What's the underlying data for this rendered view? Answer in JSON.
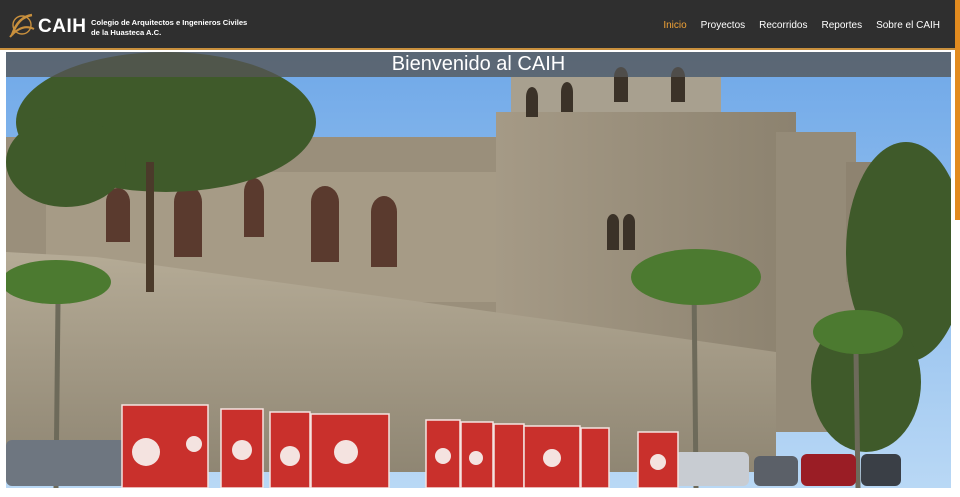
{
  "header": {
    "logo_text": "CAIH",
    "logo_subtitle": "Colegio de Arquitectos e Ingenieros Civiles de la Huasteca A.C."
  },
  "nav": {
    "items": [
      {
        "label": "Inicio",
        "active": true
      },
      {
        "label": "Proyectos",
        "active": false
      },
      {
        "label": "Recorridos",
        "active": false
      },
      {
        "label": "Reportes",
        "active": false
      },
      {
        "label": "Sobre el CAIH",
        "active": false
      }
    ]
  },
  "hero": {
    "title": "Bienvenido al CAIH"
  },
  "colors": {
    "header_bg": "#2f2f2f",
    "accent": "#f0a236",
    "letters_red": "#c9302c"
  }
}
